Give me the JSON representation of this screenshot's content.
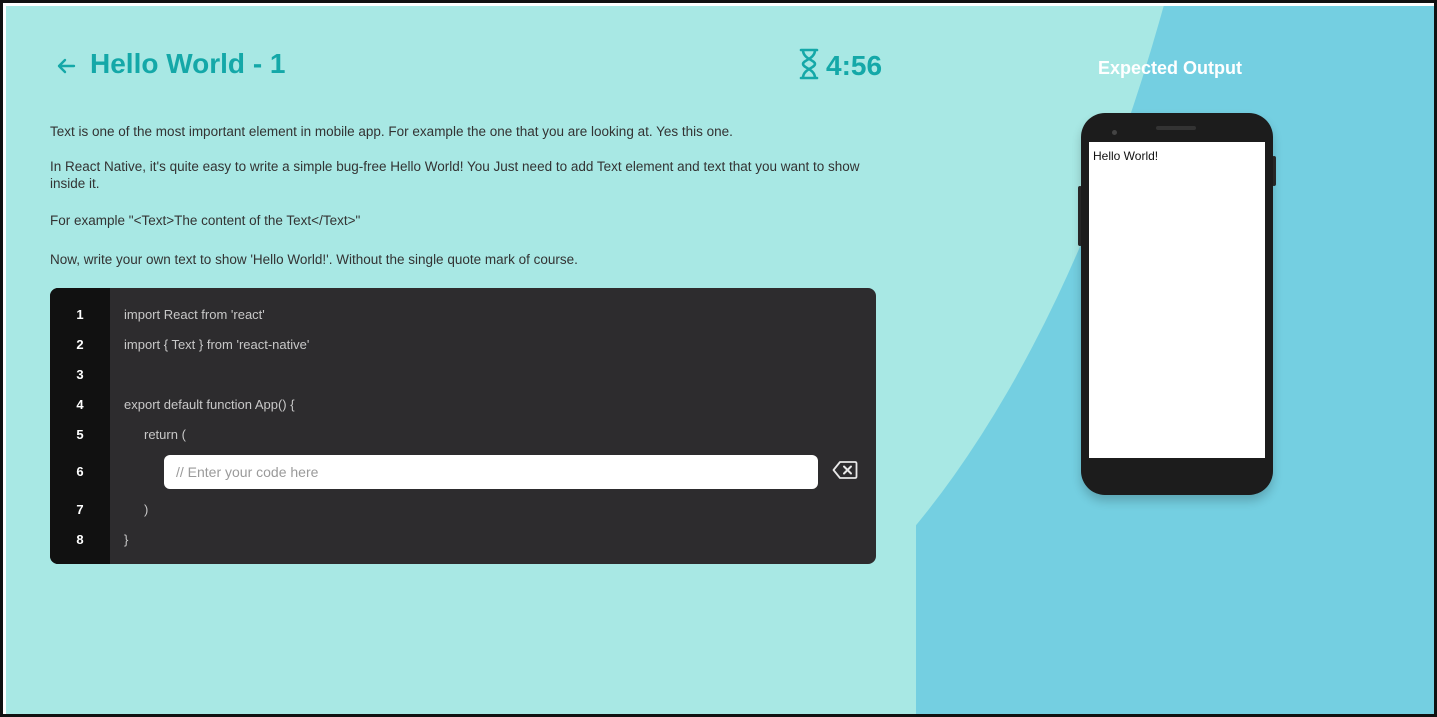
{
  "header": {
    "title": "Hello World - 1",
    "timer": "4:56"
  },
  "instructions": [
    "Text is one of the most important element in mobile app. For example the one that you are looking at. Yes this one.",
    "In React Native, it's quite easy to write a simple bug-free Hello World! You Just need to add Text element and text that you want to show inside it.",
    "For example \"<Text>The content of the Text</Text>\"",
    "Now, write your own text to show 'Hello World!'. Without the single quote mark of course."
  ],
  "editor": {
    "line_numbers": [
      "1",
      "2",
      "3",
      "4",
      "5",
      "6",
      "7",
      "8"
    ],
    "lines": {
      "l1": "import React from 'react'",
      "l2": "import { Text } from 'react-native'",
      "l3": "",
      "l4": "export default function App() {",
      "l5": "return (",
      "l7": ")",
      "l8": "}"
    },
    "input_placeholder": "// Enter your code here",
    "input_value": ""
  },
  "preview": {
    "title": "Expected Output",
    "output_text": "Hello World!"
  },
  "colors": {
    "accent": "#14a8a8",
    "left_bg": "#a8e8e4",
    "right_bg": "#74cfe1",
    "editor_bg": "#2d2c2e"
  }
}
